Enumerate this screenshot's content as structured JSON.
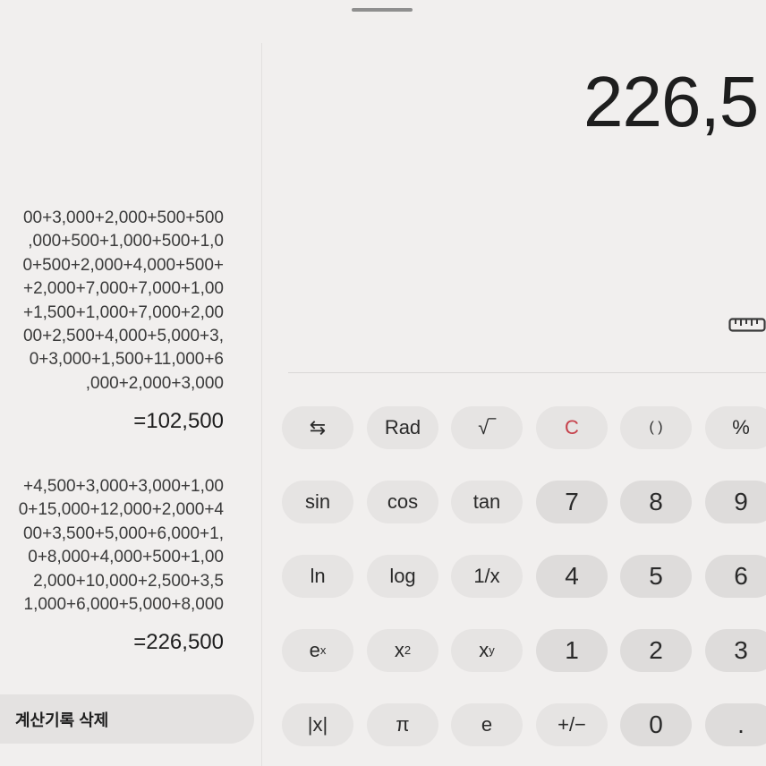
{
  "history": [
    {
      "expression_lines": [
        "00+3,000+2,000+500+500",
        ",000+500+1,000+500+1,0",
        "0+500+2,000+4,000+500+",
        "+2,000+7,000+7,000+1,00",
        "+1,500+1,000+7,000+2,00",
        "00+2,500+4,000+5,000+3,",
        "0+3,000+1,500+11,000+6",
        ",000+2,000+3,000"
      ],
      "result": "=102,500"
    },
    {
      "expression_lines": [
        "+4,500+3,000+3,000+1,00",
        "0+15,000+12,000+2,000+4",
        "00+3,500+5,000+6,000+1,",
        "0+8,000+4,000+500+1,00",
        "2,000+10,000+2,500+3,5",
        "1,000+6,000+5,000+8,000"
      ],
      "result": "=226,500"
    }
  ],
  "clear_history_label": "계산기록 삭제",
  "display": {
    "value": "226,5"
  },
  "icons": {
    "ruler": "ruler-icon"
  },
  "keys": {
    "swap": "⇆",
    "rad": "Rad",
    "sqrt": "√‾",
    "clear": "C",
    "parens": "( )",
    "percent": "%",
    "sin": "sin",
    "cos": "cos",
    "tan": "tan",
    "seven": "7",
    "eight": "8",
    "nine": "9",
    "ln": "ln",
    "log": "log",
    "inverse": "1/x",
    "four": "4",
    "five": "5",
    "six": "6",
    "exp_base": "e",
    "exp_sup": "x",
    "square_base": "x",
    "square_sup": "2",
    "power_base": "x",
    "power_sup": "y",
    "one": "1",
    "two": "2",
    "three": "3",
    "abs": "|x|",
    "pi": "π",
    "e": "e",
    "sign": "+/−",
    "zero": "0",
    "dot": "."
  },
  "colors": {
    "background": "#f1efee",
    "clear_key": "#c6414b",
    "key_bg": "#e6e4e3"
  }
}
